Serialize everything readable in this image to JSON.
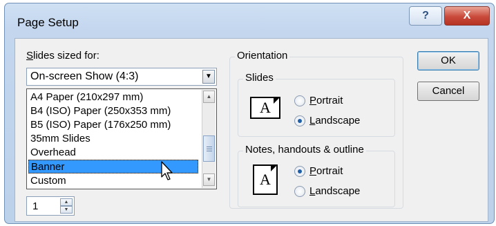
{
  "dialog": {
    "title": "Page Setup",
    "help_glyph": "?",
    "close_glyph": "X"
  },
  "slides_sized_for": {
    "label_mnemonic": "S",
    "label_rest": "lides sized for:",
    "selected": "On-screen Show (4:3)",
    "options": [
      "A4 Paper (210x297 mm)",
      "B4 (ISO) Paper (250x353 mm)",
      "B5 (ISO) Paper (176x250 mm)",
      "35mm Slides",
      "Overhead",
      "Banner",
      "Custom"
    ],
    "highlighted_option": "Banner"
  },
  "numbering": {
    "value": "1"
  },
  "orientation": {
    "group_label": "Orientation",
    "slides": {
      "group_label": "Slides",
      "portrait_mnemonic": "P",
      "portrait_rest": "ortrait",
      "landscape_mnemonic": "L",
      "landscape_rest": "andscape",
      "selected": "landscape",
      "icon_letter": "A"
    },
    "notes": {
      "group_label": "Notes, handouts & outline",
      "portrait_mnemonic": "P",
      "portrait_rest": "ortrait",
      "landscape_mnemonic": "L",
      "landscape_rest": "andscape",
      "selected": "portrait",
      "icon_letter": "A"
    }
  },
  "buttons": {
    "ok": "OK",
    "cancel": "Cancel"
  }
}
